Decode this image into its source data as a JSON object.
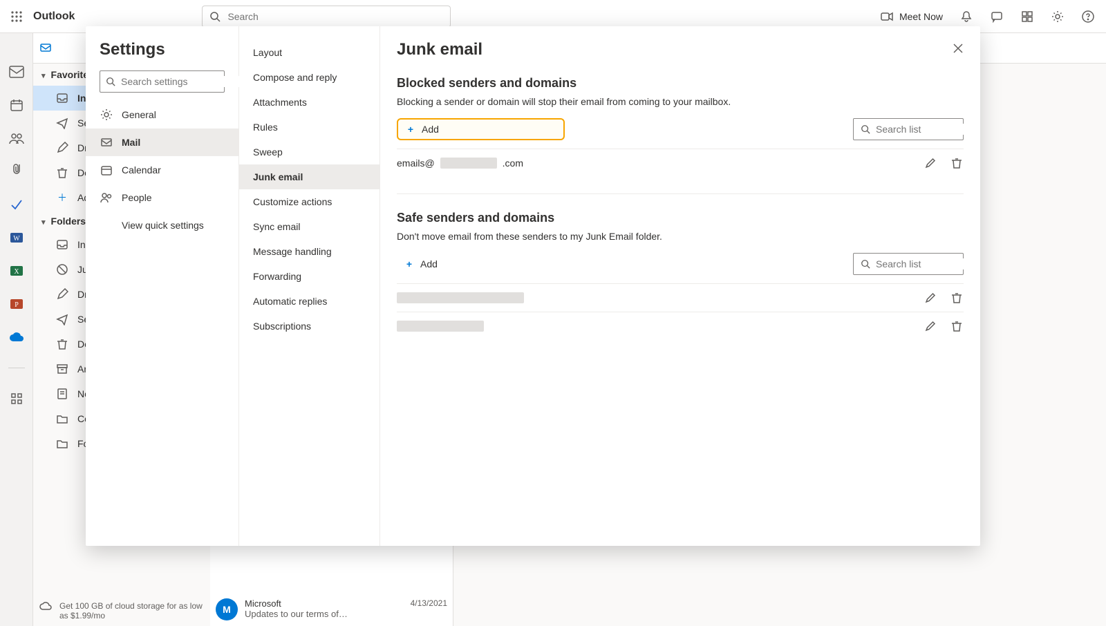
{
  "top": {
    "brand": "Outlook",
    "search_placeholder": "Search",
    "meet_now": "Meet Now"
  },
  "ribbon": {
    "new_mail_hint": "New mail"
  },
  "leftnav": {
    "group_favorites": "Favorites",
    "group_folders": "Folders",
    "items_favorites": [
      {
        "icon": "inbox",
        "label": "Inbox",
        "active": true
      },
      {
        "icon": "sent",
        "label": "Sent Items"
      },
      {
        "icon": "drafts",
        "label": "Drafts"
      },
      {
        "icon": "deleted",
        "label": "Deleted Items"
      },
      {
        "icon": "add",
        "label": "Add favorite"
      }
    ],
    "items_folders": [
      {
        "icon": "inbox",
        "label": "Inbox"
      },
      {
        "icon": "junk",
        "label": "Junk Email"
      },
      {
        "icon": "drafts",
        "label": "Drafts"
      },
      {
        "icon": "sent",
        "label": "Sent Items"
      },
      {
        "icon": "deleted",
        "label": "Deleted Items"
      },
      {
        "icon": "archive",
        "label": "Archive"
      },
      {
        "icon": "notes",
        "label": "Notes"
      },
      {
        "icon": "folder",
        "label": "Conversation History"
      },
      {
        "icon": "folder",
        "label": "Folder"
      }
    ],
    "storage_promo": "Get 100 GB of cloud storage for as low as $1.99/mo"
  },
  "msglist": {
    "sample": {
      "avatar_initial": "M",
      "sender": "Microsoft",
      "subject": "Updates to our terms of…",
      "date": "4/13/2021"
    }
  },
  "settings": {
    "title": "Settings",
    "search_placeholder": "Search settings",
    "nav": [
      {
        "icon": "general",
        "label": "General"
      },
      {
        "icon": "mail",
        "label": "Mail",
        "active": true
      },
      {
        "icon": "calendar",
        "label": "Calendar"
      },
      {
        "icon": "people",
        "label": "People"
      },
      {
        "icon": "quick",
        "label": "View quick settings"
      }
    ],
    "categories": [
      "Layout",
      "Compose and reply",
      "Attachments",
      "Rules",
      "Sweep",
      "Junk email",
      "Customize actions",
      "Sync email",
      "Message handling",
      "Forwarding",
      "Automatic replies",
      "Subscriptions"
    ],
    "categories_active_index": 5,
    "panel": {
      "title": "Junk email",
      "blocked": {
        "heading": "Blocked senders and domains",
        "desc": "Blocking a sender or domain will stop their email from coming to your mailbox.",
        "add_label": "Add",
        "search_placeholder": "Search list",
        "rows": [
          {
            "prefix": "emails@",
            "suffix": ".com",
            "redact_w": 82
          }
        ]
      },
      "safe": {
        "heading": "Safe senders and domains",
        "desc": "Don't move email from these senders to my Junk Email folder.",
        "add_label": "Add",
        "search_placeholder": "Search list",
        "rows": [
          {
            "redact_w": 184
          },
          {
            "redact_w": 126
          }
        ]
      }
    }
  }
}
